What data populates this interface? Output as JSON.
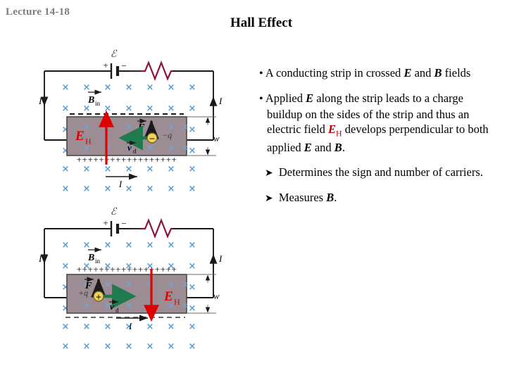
{
  "header": {
    "lecture_label": "Lecture 14-18",
    "title": "Hall Effect"
  },
  "body": {
    "bullet1": {
      "marker": "•",
      "line1": "A conducting strip in crossed",
      "sym_E": "E",
      "mid": " and ",
      "sym_B": "B",
      "line2_tail": " fields"
    },
    "bullet2": {
      "marker": "•",
      "t1": "Applied ",
      "sym_E1": "E",
      "t2": " along the strip leads to a charge buildup on the sides of the strip and thus an electric field ",
      "sym_EH": "E",
      "sub_H": "H",
      "t3": " develops perpendicular to both applied ",
      "sym_E2": "E",
      "t4": " and ",
      "sym_B": "B",
      "t5": "."
    },
    "sub1": {
      "marker": "➤",
      "text": "Determines the sign and number of carriers."
    },
    "sub2": {
      "marker": "➤",
      "t1": "Measures ",
      "sym_B": "B",
      "t2": "."
    }
  },
  "figures": [
    {
      "id": "top",
      "caption_role": "negative-carriers",
      "emf_symbol": "ℰ",
      "battery_plus": "+",
      "battery_minus": "−",
      "b_field_label": "B",
      "b_field_sub": "in",
      "current_left": "I",
      "current_right": "I",
      "current_strip": "I",
      "width_label": "w",
      "force_label": "F",
      "drift_label": "v",
      "drift_sub": "d",
      "charge_label": "−q",
      "charge_sign": "−",
      "hall_label": "E",
      "hall_sub": "H",
      "top_edge_charge": "−",
      "bottom_edge_charge": "+",
      "hall_arrow_direction": "up",
      "drift_arrow_direction": "left",
      "force_arrow_direction": "up"
    },
    {
      "id": "bottom",
      "caption_role": "positive-carriers",
      "emf_symbol": "ℰ",
      "battery_plus": "+",
      "battery_minus": "−",
      "b_field_label": "B",
      "b_field_sub": "in",
      "current_left": "I",
      "current_right": "I",
      "current_strip": "I",
      "width_label": "w",
      "force_label": "F",
      "drift_label": "v",
      "drift_sub": "d",
      "charge_label": "+q",
      "charge_sign": "+",
      "hall_label": "E",
      "hall_sub": "H",
      "top_edge_charge": "+",
      "bottom_edge_charge": "−",
      "hall_arrow_direction": "down",
      "drift_arrow_direction": "right",
      "force_arrow_direction": "up"
    }
  ],
  "colors": {
    "strip_fill": "#9c8d94",
    "strip_stroke": "#4a4a4a",
    "cross_blue": "#5b9bd5",
    "hall_red": "#e00000",
    "emf_resistor": "#8c1242",
    "drift_green": "#1f7a4d",
    "charge_yellow": "#f2d15b",
    "wire_black": "#1a1a1a",
    "lecture_gray": "#7f7f7f"
  }
}
